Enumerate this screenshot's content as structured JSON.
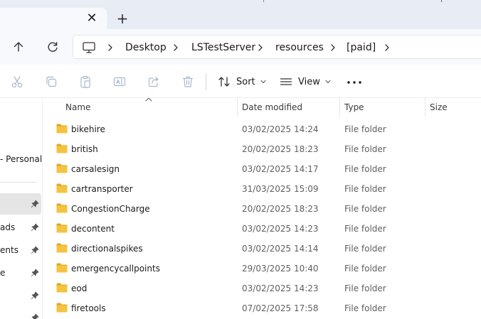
{
  "tabs": {
    "close_glyph": "✕",
    "new_glyph": "+"
  },
  "breadcrumb": {
    "items": [
      "Desktop",
      "LSTestServer",
      "resources",
      "[paid]"
    ]
  },
  "command_bar": {
    "sort_label": "Sort",
    "view_label": "View",
    "icons": [
      "cut-icon",
      "copy-icon",
      "paste-icon",
      "rename-icon",
      "share-icon",
      "delete-icon"
    ]
  },
  "nav_pane": {
    "items": [
      {
        "label": "- Personal"
      },
      {
        "label": ""
      },
      {
        "label": "ads"
      },
      {
        "label": "ents"
      },
      {
        "label": "e"
      },
      {
        "label": ""
      }
    ]
  },
  "columns": {
    "name": "Name",
    "date": "Date modified",
    "type": "Type",
    "size": "Size"
  },
  "files": [
    {
      "name": "bikehire",
      "date": "03/02/2025 14:24",
      "type": "File folder"
    },
    {
      "name": "british",
      "date": "20/02/2025 18:23",
      "type": "File folder"
    },
    {
      "name": "carsalesign",
      "date": "03/02/2025 14:17",
      "type": "File folder"
    },
    {
      "name": "cartransporter",
      "date": "31/03/2025 15:09",
      "type": "File folder"
    },
    {
      "name": "CongestionCharge",
      "date": "20/02/2025 18:23",
      "type": "File folder"
    },
    {
      "name": "decontent",
      "date": "03/02/2025 14:23",
      "type": "File folder"
    },
    {
      "name": "directionalspikes",
      "date": "03/02/2025 14:14",
      "type": "File folder"
    },
    {
      "name": "emergencycallpoints",
      "date": "29/03/2025 10:40",
      "type": "File folder"
    },
    {
      "name": "eod",
      "date": "03/02/2025 14:23",
      "type": "File folder"
    },
    {
      "name": "firetools",
      "date": "07/02/2025 17:58",
      "type": "File folder"
    }
  ],
  "colors": {
    "folder": "#f4c33f",
    "folder_dark": "#e2a81e",
    "accent": "#0067c0"
  }
}
